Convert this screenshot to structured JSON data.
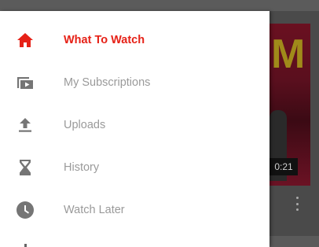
{
  "background": {
    "video_duration": "0:21"
  },
  "drawer": {
    "items": [
      {
        "label": "What To Watch",
        "icon": "home-icon",
        "active": true
      },
      {
        "label": "My Subscriptions",
        "icon": "subscriptions-icon",
        "active": false
      },
      {
        "label": "Uploads",
        "icon": "upload-icon",
        "active": false
      },
      {
        "label": "History",
        "icon": "hourglass-icon",
        "active": false
      },
      {
        "label": "Watch Later",
        "icon": "clock-icon",
        "active": false
      }
    ]
  },
  "colors": {
    "accent": "#e62117",
    "inactive": "#9a9a9a",
    "icon": "#757575"
  }
}
